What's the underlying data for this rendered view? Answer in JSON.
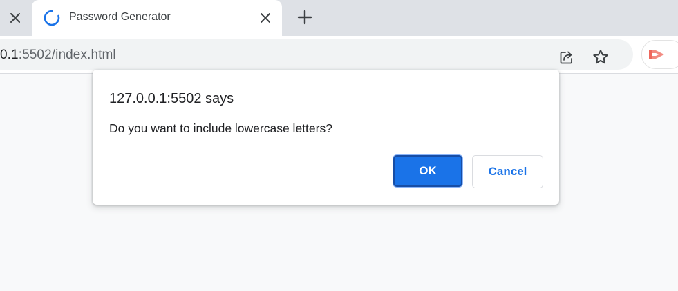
{
  "browser": {
    "tabs": [
      {
        "title": "Password Generator",
        "state": "loading"
      }
    ],
    "omnibox": {
      "url_host": "0.1",
      "url_rest": ":5502/index.html"
    },
    "icons": {
      "prev_tab_close": "close-icon",
      "tab_spinner": "loading-spinner-icon",
      "tab_close": "close-icon",
      "new_tab": "plus-icon",
      "share": "share-icon",
      "bookmark": "star-icon",
      "extension": "extension-icon"
    }
  },
  "dialog": {
    "title": "127.0.0.1:5502 says",
    "message": "Do you want to include lowercase letters?",
    "ok_label": "OK",
    "cancel_label": "Cancel"
  },
  "colors": {
    "tabbar_bg": "#dee1e6",
    "accent": "#1a73e8",
    "extension": "#f28b82"
  }
}
